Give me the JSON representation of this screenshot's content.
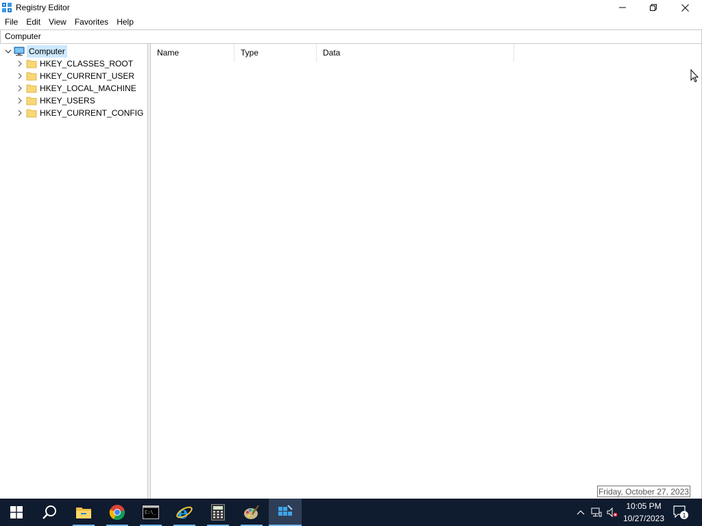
{
  "window": {
    "title": "Registry Editor",
    "app_icon": "regedit-icon"
  },
  "menu": [
    "File",
    "Edit",
    "View",
    "Favorites",
    "Help"
  ],
  "address": "Computer",
  "tree": {
    "root": "Computer",
    "keys": [
      "HKEY_CLASSES_ROOT",
      "HKEY_CURRENT_USER",
      "HKEY_LOCAL_MACHINE",
      "HKEY_USERS",
      "HKEY_CURRENT_CONFIG"
    ]
  },
  "list": {
    "columns": [
      "Name",
      "Type",
      "Data"
    ]
  },
  "tooltip": "Friday, October 27, 2023",
  "taskbar": {
    "apps": [
      "start-icon",
      "search-icon",
      "file-explorer-icon",
      "chrome-icon",
      "terminal-icon",
      "internet-explorer-icon",
      "calculator-icon",
      "paint-icon",
      "regedit-icon"
    ],
    "clock": {
      "time": "10:05 PM",
      "date": "10/27/2023"
    },
    "notification_count": "1"
  },
  "colors": {
    "selection": "#cce8ff",
    "taskbar": "#0f1b2e",
    "accent": "#76b9ed"
  }
}
